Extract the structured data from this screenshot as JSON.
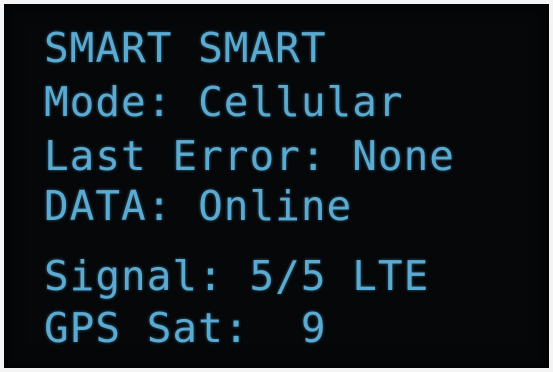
{
  "display": {
    "title": "SMART SMART",
    "mode": "Mode: Cellular",
    "last_error": "Last Error: None",
    "data_status": "DATA: Online",
    "signal": "Signal: 5/5 LTE",
    "gps_sat": "GPS Sat:  9"
  },
  "colors": {
    "text": "#5aaad2",
    "background": "#050709"
  }
}
